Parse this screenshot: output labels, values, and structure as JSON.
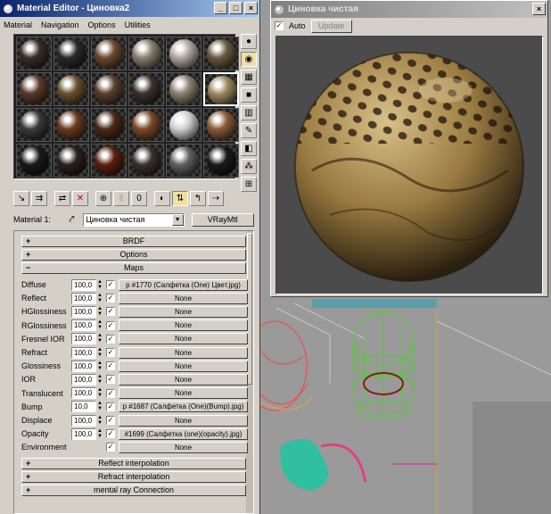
{
  "material_editor": {
    "title": "Material Editor - Цинoвка2",
    "window_buttons": [
      "_",
      "□",
      "×"
    ],
    "menu": [
      "Material",
      "Navigation",
      "Options",
      "Utilities"
    ],
    "material_label": "Material 1:",
    "material_name": "Цинoвка чистая",
    "material_type": "VRayMtl"
  },
  "rollouts": [
    {
      "sign": "+",
      "label": "BRDF"
    },
    {
      "sign": "+",
      "label": "Options"
    },
    {
      "sign": "−",
      "label": "Maps"
    }
  ],
  "maps": [
    {
      "name": "Diffuse",
      "value": "100,0",
      "checked": true,
      "map": "p #1770 (Салфетка (One) Цвет.jpg)"
    },
    {
      "name": "Reflect",
      "value": "100,0",
      "checked": true,
      "map": "None"
    },
    {
      "name": "HGlossiness",
      "value": "100,0",
      "checked": true,
      "map": "None"
    },
    {
      "name": "RGlossiness",
      "value": "100,0",
      "checked": true,
      "map": "None"
    },
    {
      "name": "Fresnel IOR",
      "value": "100,0",
      "checked": true,
      "map": "None"
    },
    {
      "name": "Refract",
      "value": "100,0",
      "checked": true,
      "map": "None"
    },
    {
      "name": "Glossiness",
      "value": "100,0",
      "checked": true,
      "map": "None"
    },
    {
      "name": "IOR",
      "value": "100,0",
      "checked": true,
      "map": "None"
    },
    {
      "name": "Translucent",
      "value": "100,0",
      "checked": true,
      "map": "None"
    },
    {
      "name": "Bump",
      "value": "10,0",
      "checked": true,
      "map": "p #1687 (Салфетка (One)(Bump).jpg)"
    },
    {
      "name": "Displace",
      "value": "100,0",
      "checked": true,
      "map": "None"
    },
    {
      "name": "Opacity",
      "value": "100,0",
      "checked": true,
      "map": "#1699 (Салфетка (one)(opacity).jpg)"
    },
    {
      "name": "Environment",
      "value": "",
      "checked": true,
      "map": "None"
    }
  ],
  "bottom_rollouts": [
    {
      "sign": "+",
      "label": "Reflect interpolation"
    },
    {
      "sign": "+",
      "label": "Refract interpolation"
    },
    {
      "sign": "+",
      "label": "mental ray Connection"
    }
  ],
  "preview": {
    "title": "Цинoвка чистая",
    "auto_label": "Auto",
    "auto_checked": true,
    "update_label": "Update",
    "close": "×"
  },
  "check_glyph": "✓",
  "slot_colors": [
    [
      "#3a2e26",
      "#2a2a2a",
      "#6a4a30",
      "#8a8070",
      "#b0a8a0",
      "#6a5a40"
    ],
    [
      "#5a3a2a",
      "#6a5030",
      "#5a4030",
      "#3a3030",
      "#8a8070",
      "#9a8860"
    ],
    [
      "#3a3a3a",
      "#6a3a20",
      "#4a2a18",
      "#7a4a28",
      "#d0d0d0",
      "#8a5a38"
    ],
    [
      "#1a1a1a",
      "#2a2020",
      "#5a2010",
      "#3a3030",
      "#606060",
      "#1a1a1a"
    ]
  ]
}
